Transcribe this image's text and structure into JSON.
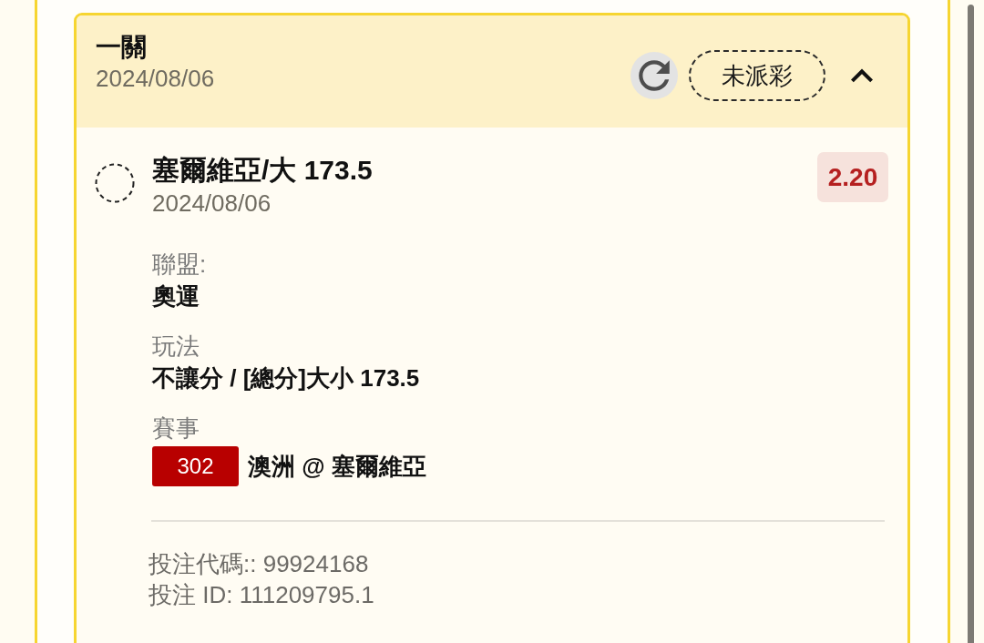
{
  "bet": {
    "title": "一關",
    "date": "2024/08/06",
    "status": "未派彩",
    "expanded": true,
    "selections": [
      {
        "title": "塞爾維亞/大 173.5",
        "date": "2024/08/06",
        "odds": "2.20",
        "fields": [
          {
            "kind": "text",
            "label": "聯盟:",
            "value": "奧運"
          },
          {
            "kind": "text",
            "label": "玩法",
            "value": "不讓分 / [總分]大小 173.5"
          },
          {
            "kind": "event",
            "label": "賽事",
            "event_number": "302",
            "value": "澳洲 @ 塞爾維亞"
          }
        ]
      }
    ],
    "footer": [
      "投注代碼:: 99924168",
      "投注 ID: 111209795.1"
    ]
  }
}
